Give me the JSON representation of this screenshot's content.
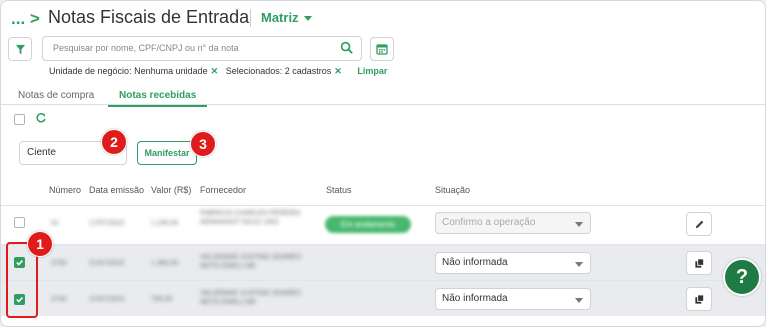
{
  "header": {
    "breadcrumb": "... >",
    "title": "Notas Fiscais de Entrada",
    "company_selector": "Matriz"
  },
  "search": {
    "placeholder": "Pesquisar por nome, CPF/CNPJ ou n° da nota"
  },
  "filters": {
    "business_unit": "Unidade de negócio: Nenhuma unidade",
    "selected": "Selecionados: 2 cadastros",
    "clear_label": "Limpar"
  },
  "tabs": [
    {
      "label": "Notas de compra",
      "active": false
    },
    {
      "label": "Notas recebidas",
      "active": true
    }
  ],
  "toolbar": {
    "manifest_select_value": "Ciente",
    "manifest_button": "Manifestar"
  },
  "callouts": [
    "1",
    "2",
    "3"
  ],
  "table": {
    "columns": [
      "Número",
      "Data emissão",
      "Valor (R$)",
      "Fornecedor",
      "Status",
      "Situação"
    ],
    "rows": [
      {
        "checked": false,
        "numero": "41",
        "data": "17/07/2023",
        "valor": "1.245,50",
        "fornecedor": "FABRICIO CHARLES PEREIRA ARMANHOT 04110 1303",
        "status": "Em andamento",
        "situacao": "Confirmo a operação",
        "situacao_disabled": true,
        "action_icon": "pencil-icon"
      },
      {
        "checked": true,
        "numero": "3750",
        "data": "21/07/2023",
        "valor": "1.380,00",
        "fornecedor": "VALDEMAR JUSTINO SOARES NETO EIRELI ME",
        "status": "",
        "situacao": "Não informada",
        "situacao_disabled": false,
        "action_icon": "copy-icon"
      },
      {
        "checked": true,
        "numero": "3734",
        "data": "21/07/2023",
        "valor": "790,00",
        "fornecedor": "VALDEMAR JUSTINO SOARES NETO EIRELI ME",
        "status": "",
        "situacao": "Não informada",
        "situacao_disabled": false,
        "action_icon": "copy-icon"
      }
    ]
  },
  "help": "?",
  "colors": {
    "accent": "#2f9e60",
    "callout": "#e01b1b",
    "help_button": "#1f7a45"
  }
}
